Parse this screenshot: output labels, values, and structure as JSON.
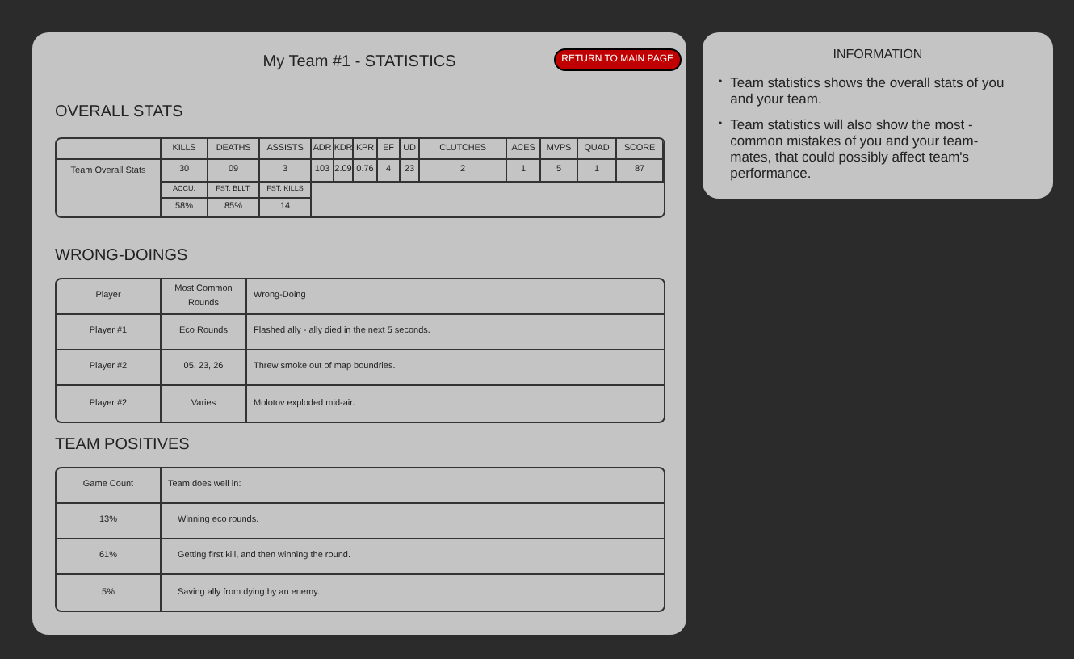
{
  "title": "My Team #1 - STATISTICS",
  "return_button": "RETURN TO MAIN PAGE",
  "overall_stats": {
    "heading": "OVERALL STATS",
    "row_label": "Team Overall Stats",
    "columns": [
      {
        "label": "KILLS",
        "value": "30"
      },
      {
        "label": "DEATHS",
        "value": "09"
      },
      {
        "label": "ASSISTS",
        "value": "3"
      },
      {
        "label": "ADR",
        "value": "103"
      },
      {
        "label": "KDR",
        "value": "2.09"
      },
      {
        "label": "KPR",
        "value": "0.76"
      },
      {
        "label": "EF",
        "value": "4"
      },
      {
        "label": "UD",
        "value": "23"
      },
      {
        "label": "CLUTCHES",
        "value": "2"
      },
      {
        "label": "ACES",
        "value": "1"
      },
      {
        "label": "MVPS",
        "value": "5"
      },
      {
        "label": "QUAD",
        "value": "1"
      },
      {
        "label": "SCORE",
        "value": "87"
      }
    ],
    "extra_columns": [
      {
        "label": "ACCU.",
        "value": "58%"
      },
      {
        "label": "FST. BLLT.",
        "value": "85%"
      },
      {
        "label": "FST. KILLS",
        "value": "14"
      }
    ]
  },
  "wrong_doings": {
    "heading": "WRONG-DOINGS",
    "columns": [
      "Player",
      "Most Common Rounds",
      "Wrong-Doing"
    ],
    "rows": [
      [
        "Player #1",
        "Eco Rounds",
        "Flashed ally - ally died in the next 5 seconds."
      ],
      [
        "Player #2",
        "05, 23, 26",
        "Threw smoke out of map boundries."
      ],
      [
        "Player #2",
        "Varies",
        "Molotov exploded mid-air."
      ]
    ]
  },
  "team_positives": {
    "heading": "TEAM POSITIVES",
    "columns": [
      "Game Count",
      "Team does well in:"
    ],
    "rows": [
      [
        "13%",
        "Winning eco rounds."
      ],
      [
        "61%",
        "Getting first kill, and then winning the round."
      ],
      [
        "5%",
        "Saving ally from dying by an enemy."
      ]
    ]
  },
  "information": {
    "title": "INFORMATION",
    "bullet": "•",
    "items": [
      "Team statistics shows the overall stats of you and your team.",
      "Team statistics will also show the most - common mistakes of you and your team-mates, that could possibly affect team's performance."
    ]
  }
}
